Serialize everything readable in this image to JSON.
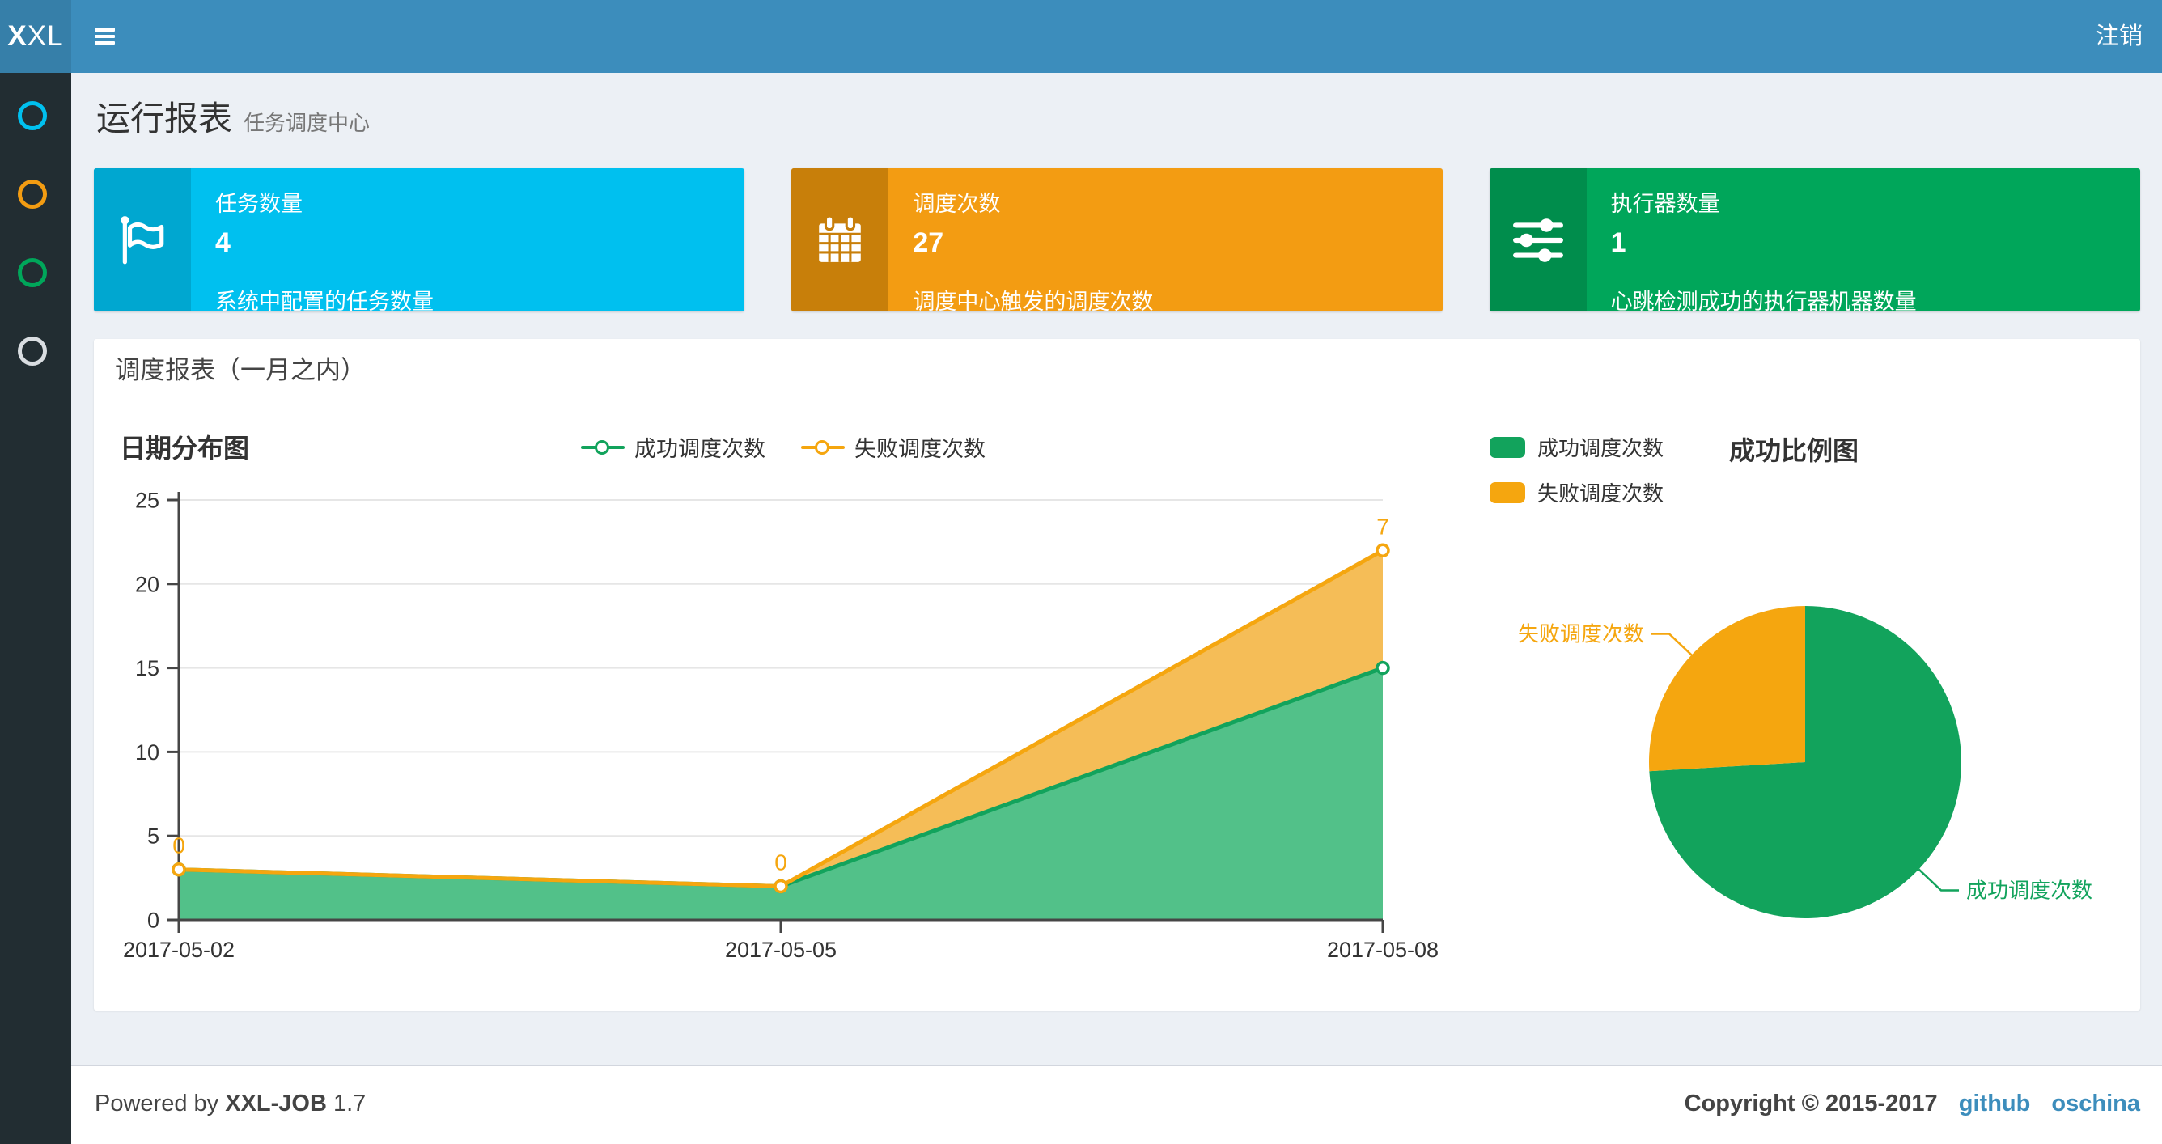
{
  "theme": {
    "navbar_bg": "#3c8dbc",
    "logo_bg": "#367fa9",
    "sidebar_bg": "#222d32",
    "content_bg": "#ecf0f5",
    "link_color": "#3c8dbc"
  },
  "navbar": {
    "logo_bold": "X",
    "logo_rest": "XL",
    "logout_label": "注销"
  },
  "sidebar": {
    "items": [
      {
        "name": "menu-run-report",
        "icon": "circle-o-icon",
        "color": "#00c0ef"
      },
      {
        "name": "menu-job-manage",
        "icon": "circle-o-icon",
        "color": "#f39c12"
      },
      {
        "name": "menu-dispatch-log",
        "icon": "circle-o-icon",
        "color": "#00a65a"
      },
      {
        "name": "menu-executor-manage",
        "icon": "circle-o-icon",
        "color": "#d9dde1"
      }
    ]
  },
  "page_header": {
    "title": "运行报表",
    "subtitle": "任务调度中心"
  },
  "info_boxes": [
    {
      "title": "任务数量",
      "value": "4",
      "desc": "系统中配置的任务数量",
      "bg": "#00c0ef",
      "icon_bg": "#00a7d0",
      "icon": "flag-icon"
    },
    {
      "title": "调度次数",
      "value": "27",
      "desc": "调度中心触发的调度次数",
      "bg": "#f39c12",
      "icon_bg": "#c87f0a",
      "icon": "calendar-icon"
    },
    {
      "title": "执行器数量",
      "value": "1",
      "desc": "心跳检测成功的执行器机器数量",
      "bg": "#00a65a",
      "icon_bg": "#008d4c",
      "icon": "sliders-icon"
    }
  ],
  "panel": {
    "title": "调度报表（一月之内）"
  },
  "chart_data": [
    {
      "type": "area",
      "title": "日期分布图",
      "categories": [
        "2017-05-02",
        "2017-05-05",
        "2017-05-08"
      ],
      "stacked": true,
      "series": [
        {
          "name": "成功调度次数",
          "values": [
            3,
            2,
            15
          ],
          "color": "#12a35c",
          "fill": "#52c189"
        },
        {
          "name": "失败调度次数",
          "values": [
            0,
            0,
            7
          ],
          "color": "#f5a60f",
          "fill": "#f5bd57"
        }
      ],
      "point_labels": {
        "series": "失败调度次数",
        "values": [
          0,
          0,
          7
        ]
      },
      "ylabel": "",
      "xlabel": "",
      "ylim": [
        0,
        25
      ],
      "ytick_step": 5,
      "grid": true,
      "legend_position": "top-center"
    },
    {
      "type": "pie",
      "title": "成功比例图",
      "slices": [
        {
          "label": "成功调度次数",
          "value": 20,
          "color": "#12a35c"
        },
        {
          "label": "失败调度次数",
          "value": 7,
          "color": "#f5a60f"
        }
      ],
      "legend_position": "top-left",
      "start_angle": "top",
      "direction": "clockwise"
    }
  ],
  "footer": {
    "powered_prefix": "Powered by",
    "product": "XXL-JOB",
    "version": "1.7",
    "copyright": "Copyright © 2015-2017",
    "links": [
      "github",
      "oschina"
    ]
  }
}
